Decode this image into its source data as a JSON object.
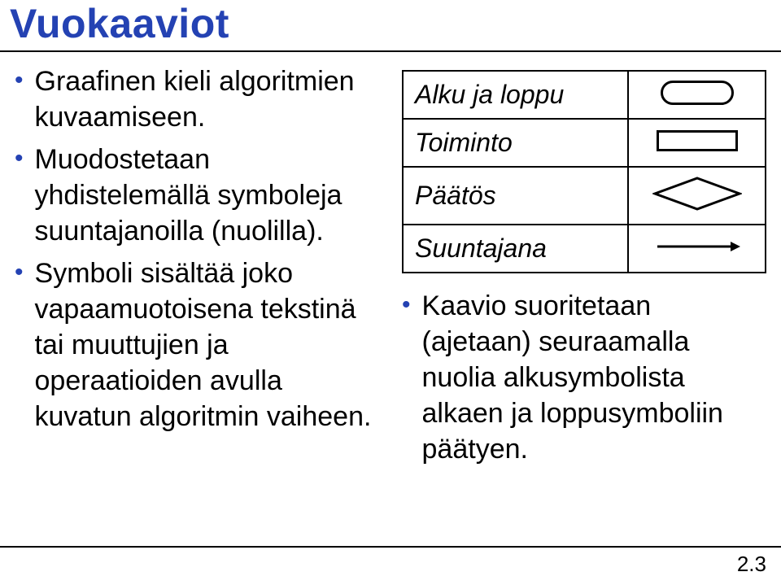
{
  "title": "Vuokaaviot",
  "left_bullets": [
    "Graafinen kieli algoritmien kuvaamiseen.",
    "Muodostetaan yhdistelemällä symboleja suuntajanoilla (nuolilla).",
    "Symboli sisältää joko vapaamuotoisena tekstinä tai muuttujien ja operaatioiden avulla kuvatun algoritmin vaiheen."
  ],
  "table_rows": [
    {
      "label": "Alku ja loppu",
      "symbol": "terminator"
    },
    {
      "label": "Toiminto",
      "symbol": "process"
    },
    {
      "label": "Päätös",
      "symbol": "decision"
    },
    {
      "label": "Suuntajana",
      "symbol": "arrow"
    }
  ],
  "right_bullet": "Kaavio suoritetaan (ajetaan) seuraamalla nuolia alkusymbolista alkaen ja loppusymboliin päätyen.",
  "page_number": "2.3"
}
